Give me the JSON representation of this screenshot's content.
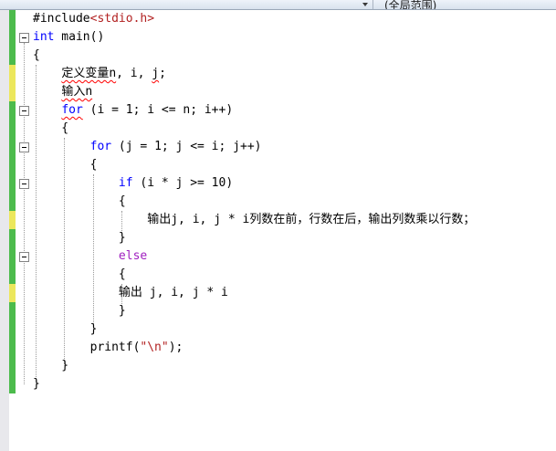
{
  "navbar": {
    "left_dropdown": {
      "label": ""
    },
    "right_dropdown": {
      "label": "(全局范围)"
    }
  },
  "editor": {
    "colors": {
      "keyword": "#0000ff",
      "keyword2": "#a020c0",
      "string": "#b22222",
      "squiggle": "#ff0000",
      "green": "#4cbb4c",
      "yellow": "#ece75c",
      "guide": "#9a9a9a",
      "margin": "#e8e8ec"
    },
    "lines": [
      {
        "change": "green",
        "fold": false,
        "segments": [
          {
            "t": "#include",
            "c": "plain"
          },
          {
            "t": "<stdio.h>",
            "c": "string"
          }
        ]
      },
      {
        "change": "green",
        "fold": true,
        "segments": [
          {
            "t": "int",
            "c": "keyword"
          },
          {
            "t": " main()",
            "c": "plain"
          }
        ]
      },
      {
        "change": "green",
        "fold": false,
        "segments": [
          {
            "t": "{",
            "c": "plain"
          }
        ]
      },
      {
        "change": "yellow",
        "fold": false,
        "segments": [
          {
            "t": "    ",
            "c": "plain"
          },
          {
            "t": "定义变量n",
            "c": "plain",
            "sq": true
          },
          {
            "t": ", i, ",
            "c": "plain"
          },
          {
            "t": "j",
            "c": "plain",
            "sq": true
          },
          {
            "t": ";",
            "c": "plain"
          }
        ]
      },
      {
        "change": "yellow",
        "fold": false,
        "segments": [
          {
            "t": "    ",
            "c": "plain"
          },
          {
            "t": "输入n",
            "c": "plain",
            "sq": true
          }
        ]
      },
      {
        "change": "green",
        "fold": true,
        "segments": [
          {
            "t": "    ",
            "c": "plain"
          },
          {
            "t": "for",
            "c": "keyword",
            "sq": true
          },
          {
            "t": " (i = 1; i <= n; i++)",
            "c": "plain"
          }
        ]
      },
      {
        "change": "green",
        "fold": false,
        "segments": [
          {
            "t": "    {",
            "c": "plain"
          }
        ]
      },
      {
        "change": "green",
        "fold": true,
        "segments": [
          {
            "t": "        ",
            "c": "plain"
          },
          {
            "t": "for",
            "c": "keyword"
          },
          {
            "t": " (j = 1; j <= i; j++)",
            "c": "plain"
          }
        ]
      },
      {
        "change": "green",
        "fold": false,
        "segments": [
          {
            "t": "        {",
            "c": "plain"
          }
        ]
      },
      {
        "change": "green",
        "fold": true,
        "segments": [
          {
            "t": "            ",
            "c": "plain"
          },
          {
            "t": "if",
            "c": "keyword"
          },
          {
            "t": " (i * j >= 10)",
            "c": "plain"
          }
        ]
      },
      {
        "change": "green",
        "fold": false,
        "segments": [
          {
            "t": "            {",
            "c": "plain"
          }
        ]
      },
      {
        "change": "yellow",
        "fold": false,
        "segments": [
          {
            "t": "                ",
            "c": "plain"
          },
          {
            "t": "输出j, i, j * i列数在前，行数在后，输出列数乘以行数；",
            "c": "plain"
          }
        ]
      },
      {
        "change": "green",
        "fold": false,
        "segments": [
          {
            "t": "            }",
            "c": "plain"
          }
        ]
      },
      {
        "change": "green",
        "fold": true,
        "segments": [
          {
            "t": "            ",
            "c": "plain"
          },
          {
            "t": "else",
            "c": "keyword2"
          }
        ]
      },
      {
        "change": "green",
        "fold": false,
        "segments": [
          {
            "t": "            {",
            "c": "plain"
          }
        ]
      },
      {
        "change": "yellow",
        "fold": false,
        "segments": [
          {
            "t": "            ",
            "c": "plain"
          },
          {
            "t": "输出 j, i, j * i",
            "c": "plain"
          }
        ]
      },
      {
        "change": "green",
        "fold": false,
        "segments": [
          {
            "t": "            }",
            "c": "plain"
          }
        ]
      },
      {
        "change": "green",
        "fold": false,
        "segments": [
          {
            "t": "        }",
            "c": "plain"
          }
        ]
      },
      {
        "change": "green",
        "fold": false,
        "segments": [
          {
            "t": "        printf(",
            "c": "plain"
          },
          {
            "t": "\"\\n\"",
            "c": "string"
          },
          {
            "t": ");",
            "c": "plain"
          }
        ]
      },
      {
        "change": "green",
        "fold": false,
        "segments": [
          {
            "t": "    }",
            "c": "plain"
          }
        ]
      },
      {
        "change": "green",
        "fold": false,
        "segments": [
          {
            "t": "}",
            "c": "plain"
          }
        ]
      }
    ],
    "guides": [
      {
        "col": 0,
        "from": 4,
        "to": 21
      },
      {
        "col": 4,
        "from": 8,
        "to": 20
      },
      {
        "col": 8,
        "from": 10,
        "to": 18
      },
      {
        "col": 12,
        "from": 12,
        "to": 13
      },
      {
        "col": 12,
        "from": 16,
        "to": 17
      }
    ],
    "fold_guide": {
      "from": 3,
      "to": 21
    }
  }
}
